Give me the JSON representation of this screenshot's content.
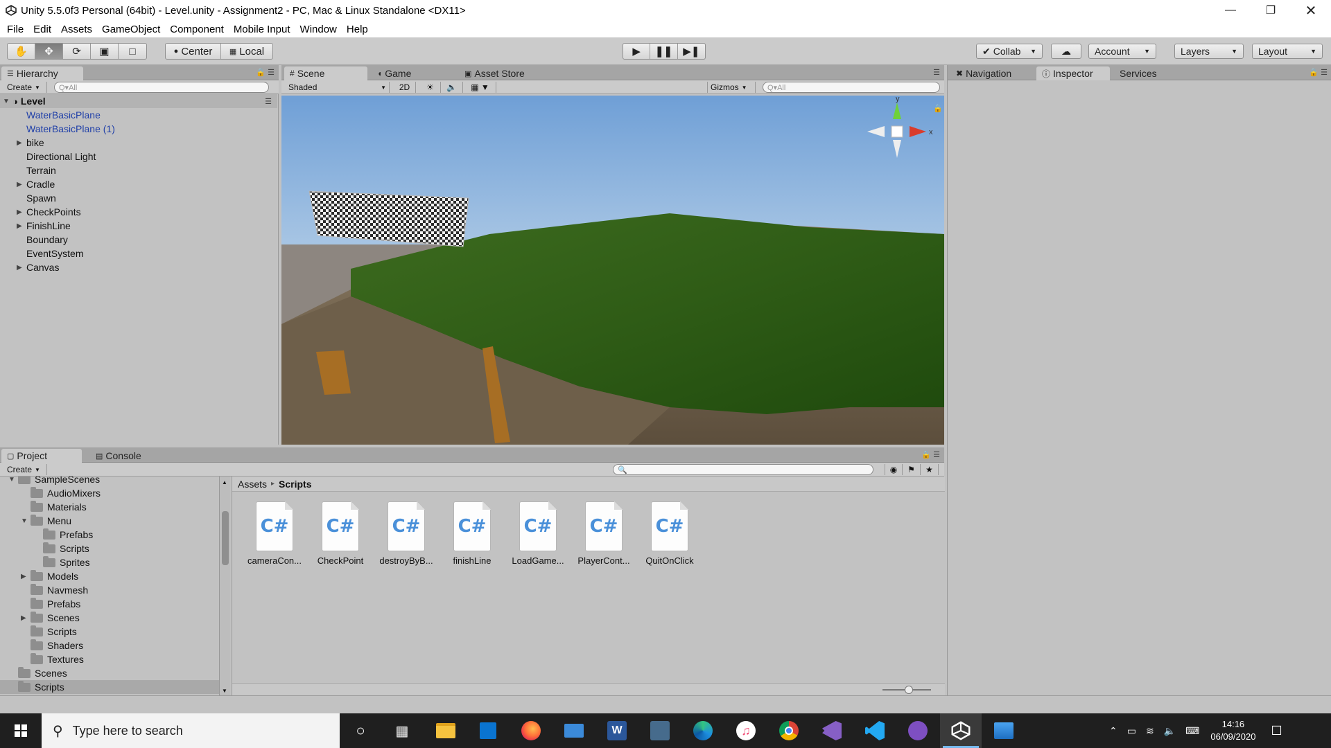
{
  "window": {
    "title": "Unity 5.5.0f3 Personal (64bit) - Level.unity - Assignment2 - PC, Mac & Linux Standalone <DX11>",
    "minimize_icon": "minimize-icon",
    "maximize_icon": "restore-icon",
    "close_icon": "close-icon"
  },
  "menu": [
    "File",
    "Edit",
    "Assets",
    "GameObject",
    "Component",
    "Mobile Input",
    "Window",
    "Help"
  ],
  "toolbar": {
    "pivot": "Center",
    "space": "Local",
    "collab": "Collab",
    "account": "Account",
    "layers": "Layers",
    "layout": "Layout"
  },
  "hierarchy": {
    "tab": "Hierarchy",
    "create": "Create",
    "search_placeholder": "Q▾All",
    "scene": "Level",
    "items": [
      {
        "label": "WaterBasicPlane",
        "prefab": true,
        "expandable": false
      },
      {
        "label": "WaterBasicPlane (1)",
        "prefab": true,
        "expandable": false
      },
      {
        "label": "bike",
        "prefab": false,
        "expandable": true
      },
      {
        "label": "Directional Light",
        "prefab": false,
        "expandable": false
      },
      {
        "label": "Terrain",
        "prefab": false,
        "expandable": false
      },
      {
        "label": "Cradle",
        "prefab": false,
        "expandable": true
      },
      {
        "label": "Spawn",
        "prefab": false,
        "expandable": false
      },
      {
        "label": "CheckPoints",
        "prefab": false,
        "expandable": true
      },
      {
        "label": "FinishLine",
        "prefab": false,
        "expandable": true
      },
      {
        "label": "Boundary",
        "prefab": false,
        "expandable": false
      },
      {
        "label": "EventSystem",
        "prefab": false,
        "expandable": false
      },
      {
        "label": "Canvas",
        "prefab": false,
        "expandable": true
      }
    ]
  },
  "scene": {
    "tabs": [
      "Scene",
      "Game",
      "Asset Store"
    ],
    "shading": "Shaded",
    "mode2d": "2D",
    "gizmos": "Gizmos",
    "search_placeholder": "Q▾All",
    "gizmo_axes": {
      "y": "y",
      "x": "x"
    }
  },
  "inspector": {
    "tabs": [
      "Navigation",
      "Inspector",
      "Services"
    ]
  },
  "project": {
    "tabs": [
      "Project",
      "Console"
    ],
    "create": "Create",
    "breadcrumb_root": "Assets",
    "breadcrumb_sep": "▸",
    "breadcrumb_current": "Scripts",
    "tree": [
      {
        "label": "SampleScenes",
        "indent": 1,
        "arrow": "▼"
      },
      {
        "label": "AudioMixers",
        "indent": 2,
        "arrow": ""
      },
      {
        "label": "Materials",
        "indent": 2,
        "arrow": ""
      },
      {
        "label": "Menu",
        "indent": 2,
        "arrow": "▼"
      },
      {
        "label": "Prefabs",
        "indent": 3,
        "arrow": ""
      },
      {
        "label": "Scripts",
        "indent": 3,
        "arrow": ""
      },
      {
        "label": "Sprites",
        "indent": 3,
        "arrow": ""
      },
      {
        "label": "Models",
        "indent": 2,
        "arrow": "▶"
      },
      {
        "label": "Navmesh",
        "indent": 2,
        "arrow": ""
      },
      {
        "label": "Prefabs",
        "indent": 2,
        "arrow": ""
      },
      {
        "label": "Scenes",
        "indent": 2,
        "arrow": "▶"
      },
      {
        "label": "Scripts",
        "indent": 2,
        "arrow": ""
      },
      {
        "label": "Shaders",
        "indent": 2,
        "arrow": ""
      },
      {
        "label": "Textures",
        "indent": 2,
        "arrow": ""
      },
      {
        "label": "Scenes",
        "indent": 1,
        "arrow": ""
      },
      {
        "label": "Scripts",
        "indent": 1,
        "arrow": "",
        "selected": true
      }
    ],
    "assets": [
      "cameraCon...",
      "CheckPoint",
      "destroyByB...",
      "finishLine",
      "LoadGame...",
      "PlayerCont...",
      "QuitOnClick"
    ],
    "asset_glyph": "C#"
  },
  "taskbar": {
    "search_placeholder": "Type here to search",
    "time": "14:16",
    "date": "06/09/2020"
  },
  "colors": {
    "prefab_text": "#1f3fa8",
    "accent": "#76b9ed"
  }
}
